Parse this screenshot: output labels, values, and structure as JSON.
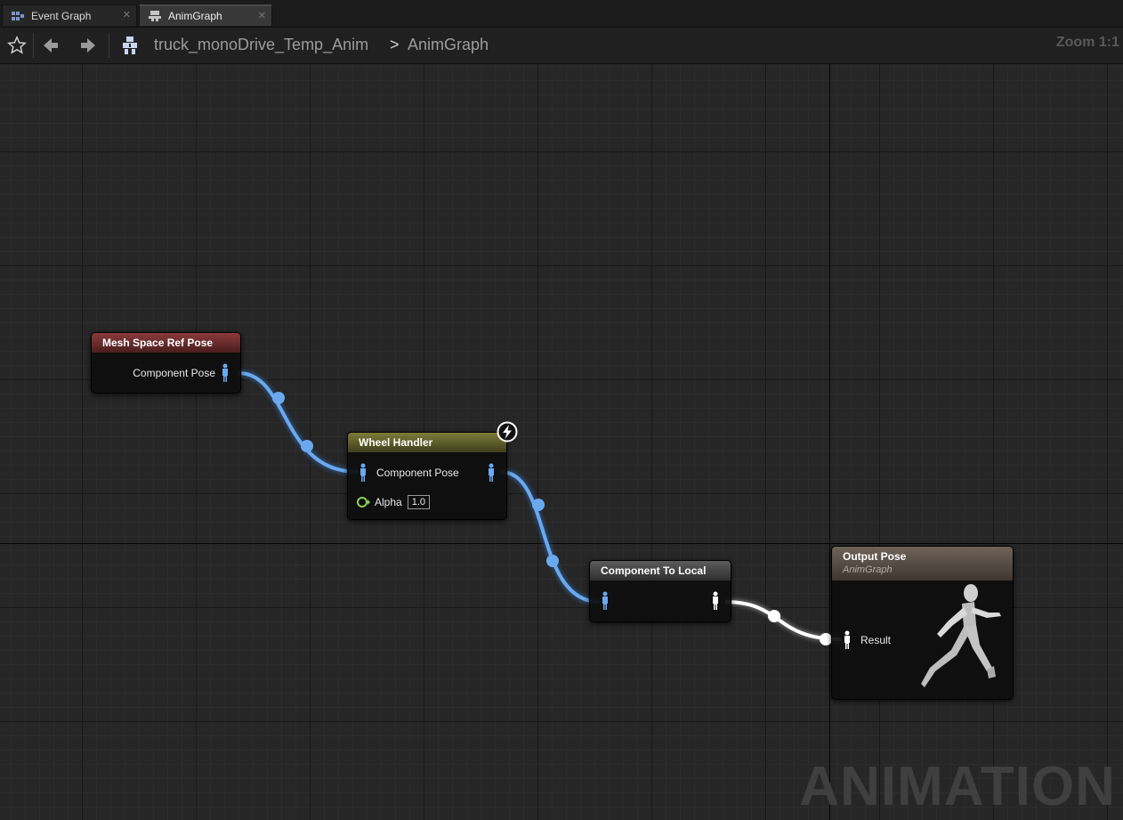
{
  "tabs": [
    {
      "label": "Event Graph",
      "icon": "event-graph-icon"
    },
    {
      "label": "AnimGraph",
      "icon": "anim-graph-icon"
    }
  ],
  "toolbar": {
    "breadcrumb": [
      "truck_monoDrive_Temp_Anim",
      "AnimGraph"
    ],
    "separator": ">",
    "zoom": "Zoom 1:1"
  },
  "watermark": "ANIMATION",
  "nodes": {
    "mesh_space_ref_pose": {
      "title": "Mesh Space Ref Pose",
      "output_label": "Component Pose",
      "header_color": "#6b2a2a"
    },
    "wheel_handler": {
      "title": "Wheel Handler",
      "input_label": "Component Pose",
      "alpha_label": "Alpha",
      "alpha_value": "1.0",
      "header_color": "#5e5e2a"
    },
    "component_to_local": {
      "title": "Component To Local",
      "header_color": "#4a4a4a"
    },
    "output_pose": {
      "title": "Output Pose",
      "subtitle": "AnimGraph",
      "input_label": "Result",
      "header_color": "#5a5048"
    }
  },
  "colors": {
    "component_pose_wire": "#6aa9ee",
    "local_pose_wire": "#ffffff",
    "alpha_pin": "#8fd14f"
  }
}
